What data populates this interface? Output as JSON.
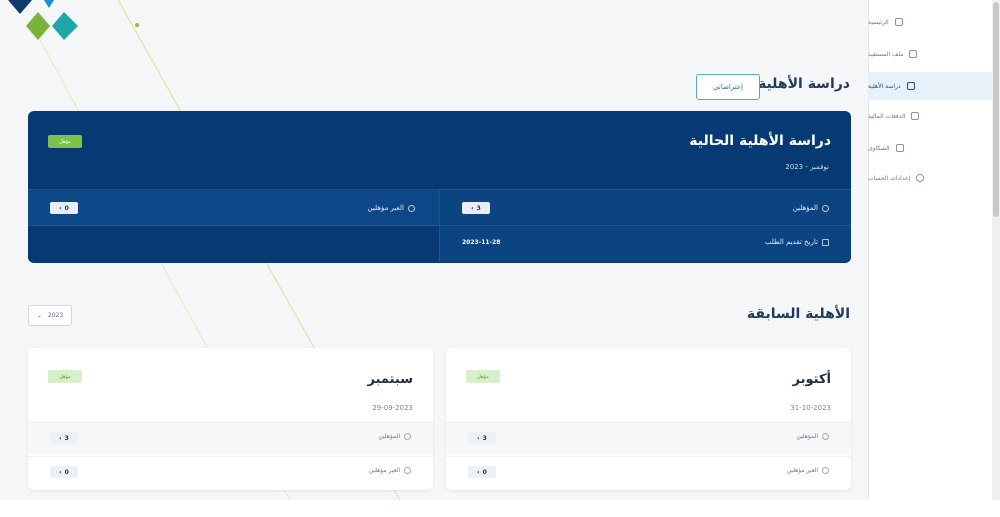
{
  "sidebar": {
    "items": [
      {
        "label": "الرئيسية",
        "icon": "home-icon",
        "active": false
      },
      {
        "label": "ملف المستفيد",
        "icon": "profile-icon",
        "active": false
      },
      {
        "label": "دراسة الأهلية",
        "icon": "users-icon",
        "active": true
      },
      {
        "label": "الدفعات المالية",
        "icon": "document-icon",
        "active": false
      },
      {
        "label": "الشكاوى",
        "icon": "shield-icon",
        "active": false
      },
      {
        "label": "إعدادات الحساب",
        "icon": "gear-icon",
        "active": false
      }
    ]
  },
  "header": {
    "title": "دراسة الأهلية",
    "objection_label": "إعتراضاتي"
  },
  "current": {
    "title": "دراسة الأهلية الحالية",
    "period": "نوفمبر - 2023",
    "status": "مؤهل",
    "eligible_label": "المؤهلين",
    "eligible_count": "3",
    "ineligible_label": "الغير مؤهلين",
    "ineligible_count": "0",
    "submit_date_label": "تاريخ تقديم الطلب",
    "submit_date_value": "2023-11-28"
  },
  "previous": {
    "title": "الأهلية السابقة",
    "year": "2023",
    "cards": [
      {
        "month": "أكتوبر",
        "date": "31-10-2023",
        "status": "مؤهل",
        "eligible_label": "المؤهلين",
        "eligible_count": "3",
        "ineligible_label": "الغير مؤهلين",
        "ineligible_count": "0"
      },
      {
        "month": "سبتمبر",
        "date": "29-09-2023",
        "status": "مؤهل",
        "eligible_label": "المؤهلين",
        "eligible_count": "3",
        "ineligible_label": "الغير مؤهلين",
        "ineligible_count": "0"
      }
    ]
  },
  "colors": {
    "primary": "#073a73",
    "accent": "#5aa6c9",
    "success": "#7bc24a"
  }
}
